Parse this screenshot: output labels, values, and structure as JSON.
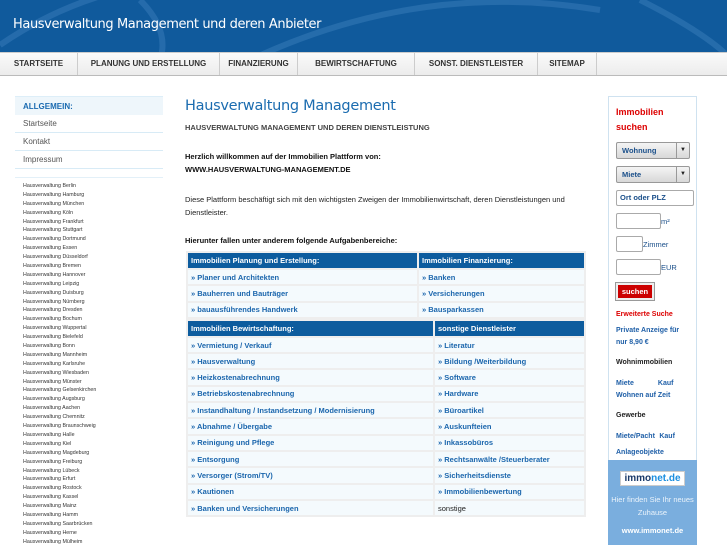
{
  "header": {
    "title": "Hausverwaltung Management und deren Anbieter"
  },
  "nav": [
    {
      "label": "STARTSEITE",
      "w": 78
    },
    {
      "label": "PLANUNG UND ERSTELLUNG",
      "w": 142
    },
    {
      "label": "FINANZIERUNG",
      "w": 78
    },
    {
      "label": "BEWIRTSCHAFTUNG",
      "w": 117
    },
    {
      "label": "SONST. DIENSTLEISTER",
      "w": 123
    },
    {
      "label": "SITEMAP",
      "w": 59
    }
  ],
  "sidebar": {
    "heading": "ALLGEMEIN:",
    "items": [
      "Startseite",
      "Kontakt",
      "Impressum"
    ],
    "cities": [
      "Hausverwaltung Berlin",
      "Hausverwaltung Hamburg",
      "Hausverwaltung München",
      "Hausverwaltung Köln",
      "Hausverwaltung Frankfurt",
      "Hausverwaltung Stuttgart",
      "Hausverwaltung Dortmund",
      "Hausverwaltung Essen",
      "Hausverwaltung Düsseldorf",
      "Hausverwaltung Bremen",
      "Hausverwaltung Hannover",
      "Hausverwaltung Leipzig",
      "Hausverwaltung Duisburg",
      "Hausverwaltung Nürnberg",
      "Hausverwaltung Dresden",
      "Hausverwaltung Bochum",
      "Hausverwaltung Wuppertal",
      "Hausverwaltung Bielefeld",
      "Hausverwaltung Bonn",
      "Hausverwaltung Mannheim",
      "Hausverwaltung Karlsruhe",
      "Hausverwaltung Wiesbaden",
      "Hausverwaltung Münster",
      "Hausverwaltung Gelsenkirchen",
      "Hausverwaltung Augsburg",
      "Hausverwaltung Aachen",
      "Hausverwaltung Chemnitz",
      "Hausverwaltung Braunschweig",
      "Hausverwaltung Halle",
      "Hausverwaltung Kiel",
      "Hausverwaltung Magdeburg",
      "Hausverwaltung Freiburg",
      "Hausverwaltung Lübeck",
      "Hausverwaltung Erfurt",
      "Hausverwaltung Rostock",
      "Hausverwaltung Kassel",
      "Hausverwaltung Mainz",
      "Hausverwaltung Hamm",
      "Hausverwaltung Saarbrücken",
      "Hausverwaltung Herne",
      "Hausverwaltung Mülheim"
    ]
  },
  "main": {
    "title": "Hausverwaltung Management",
    "subtitle": "HAUSVERWALTUNG MANAGEMENT UND DEREN DIENSTLEISTUNG",
    "welcome1": "Herzlich willkommen auf der Immobilien Plattform von:",
    "welcome2": "WWW.HAUSVERWALTUNG-MANAGEMENT.DE",
    "intro": "Diese Plattform beschäftigt sich mit den wichtigsten Zweigen der Immobilienwirtschaft, deren Dienstleistungen und Dienstleister.",
    "tasks_heading": "Hierunter fallen unter anderem folgende Aufgabenbereiche:",
    "table1": {
      "headers": [
        "Immobilien Planung und Erstellung:",
        "Immobilien Finanzierung:"
      ],
      "rows": [
        [
          "» Planer und Architekten",
          "» Banken"
        ],
        [
          "» Bauherren und Bauträger",
          "» Versicherungen"
        ],
        [
          "» bauausführendes Handwerk",
          "» Bausparkassen"
        ]
      ]
    },
    "table2": {
      "headers": [
        "Immobilien Bewirtschaftung:",
        "sonstige Dienstleister"
      ],
      "rows": [
        [
          "» Vermietung / Verkauf",
          "» Literatur"
        ],
        [
          "» Hausverwaltung",
          "» Bildung /Weiterbildung"
        ],
        [
          "» Heizkostenabrechnung",
          "» Software"
        ],
        [
          "» Betriebskostenabrechnung",
          "» Hardware"
        ],
        [
          "» Instandhaltung / Instandsetzung / Modernisierung",
          "» Büroartikel"
        ],
        [
          "» Abnahme / Übergabe",
          "» Auskunfteien"
        ],
        [
          "» Reinigung und Pflege",
          "» Inkassobüros"
        ],
        [
          "» Entsorgung",
          "» Rechtsanwälte /Steuerberater"
        ],
        [
          "» Versorger (Strom/TV)",
          "» Sicherheitsdienste"
        ],
        [
          "» Kautionen",
          "» Immobilienbewertung"
        ],
        [
          "» Banken und Versicherungen",
          "sonstige"
        ]
      ]
    }
  },
  "search": {
    "title": "Immobilien suchen",
    "type": "Wohnung",
    "mode": "Miete",
    "location_value": "Ort oder PLZ",
    "area_unit": "m²",
    "rooms_label": "Zimmer",
    "price_unit": "EUR",
    "button": "suchen",
    "advanced": "Erweiterte Suche",
    "private_ad": "Private Anzeige für nur 8,90 €",
    "wohn_heading": "Wohnimmobilien",
    "wohn_miete": "Miete",
    "wohn_kauf": "Kauf",
    "wohn_zeit": "Wohnen auf Zeit",
    "gew_heading": "Gewerbe",
    "gew_miete": "Miete/Pacht",
    "gew_kauf": "Kauf",
    "anlage": "Anlageobjekte"
  },
  "banner": {
    "logo_a": "immo",
    "logo_b": "net.de",
    "text": "Hier finden Sie Ihr neues Zuhause",
    "url": "www.immonet.de"
  }
}
